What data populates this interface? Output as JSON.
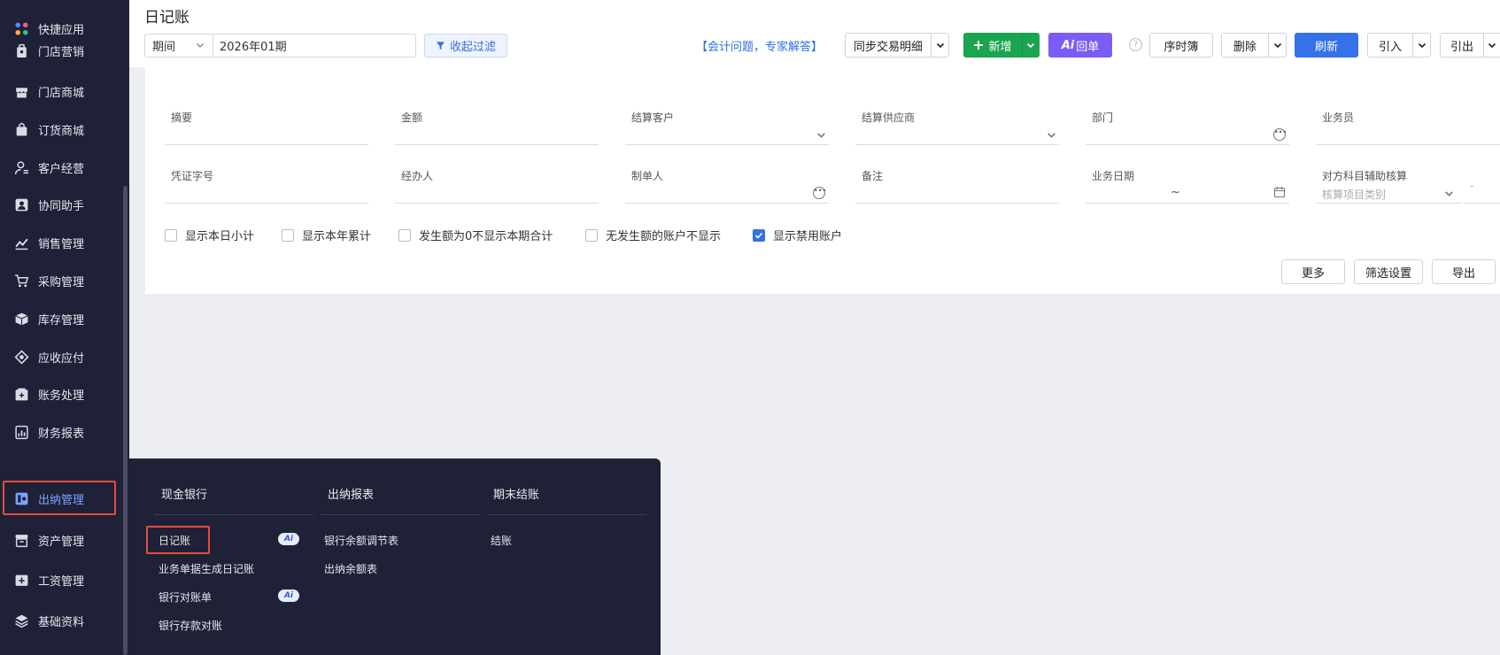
{
  "sidebar": {
    "items": [
      {
        "label": "快捷应用",
        "icon": "apps-icon"
      },
      {
        "label": "门店营销",
        "icon": "store-marketing-icon"
      },
      {
        "label": "门店商城",
        "icon": "store-mall-icon"
      },
      {
        "label": "订货商城",
        "icon": "order-mall-icon"
      },
      {
        "label": "客户经营",
        "icon": "customer-icon"
      },
      {
        "label": "协同助手",
        "icon": "collab-icon"
      },
      {
        "label": "销售管理",
        "icon": "sales-icon"
      },
      {
        "label": "采购管理",
        "icon": "cart-icon"
      },
      {
        "label": "库存管理",
        "icon": "inventory-icon"
      },
      {
        "label": "应收应付",
        "icon": "receivable-icon"
      },
      {
        "label": "账务处理",
        "icon": "ledger-icon"
      },
      {
        "label": "财务报表",
        "icon": "report-icon"
      },
      {
        "label": "出纳管理",
        "icon": "cashier-icon"
      },
      {
        "label": "资产管理",
        "icon": "asset-icon"
      },
      {
        "label": "工资管理",
        "icon": "salary-icon"
      },
      {
        "label": "基础资料",
        "icon": "layers-icon"
      }
    ],
    "active": "出纳管理"
  },
  "header": {
    "title": "日记账",
    "period_label": "期间",
    "period_value": "2026年01期",
    "collapse_filter": "收起过滤",
    "expert_link": "【会计问题，专家解答】",
    "buttons": {
      "sync": "同步交易明细",
      "add": "新增",
      "ai_receipt": "回单",
      "ai_prefix": "Ai",
      "journal_book": "序时簿",
      "delete": "删除",
      "refresh": "刷新",
      "import": "引入",
      "export_out": "引出"
    },
    "help": "?"
  },
  "filters": {
    "row1": [
      {
        "label": "摘要"
      },
      {
        "label": "金额"
      },
      {
        "label": "结算客户"
      },
      {
        "label": "结算供应商"
      },
      {
        "label": "部门"
      },
      {
        "label": "业务员"
      }
    ],
    "row2": [
      {
        "label": "凭证字号"
      },
      {
        "label": "经办人"
      },
      {
        "label": "制单人"
      },
      {
        "label": "备注"
      },
      {
        "label": "业务日期",
        "separator": "~"
      },
      {
        "label": "对方科目辅助核算",
        "placeholder": "核算项目类别",
        "suffix": "-"
      }
    ],
    "checkboxes": [
      {
        "label": "显示本日小计",
        "checked": false
      },
      {
        "label": "显示本年累计",
        "checked": false
      },
      {
        "label": "发生额为0不显示本期合计",
        "checked": false
      },
      {
        "label": "无发生额的账户不显示",
        "checked": false
      },
      {
        "label": "显示禁用账户",
        "checked": true
      }
    ],
    "actions": {
      "more": "更多",
      "filter_settings": "筛选设置",
      "export": "导出"
    }
  },
  "popup": {
    "columns": [
      {
        "title": "现金银行",
        "items": [
          {
            "label": "日记账",
            "ai": true
          },
          {
            "label": "业务单据生成日记账",
            "ai": false
          },
          {
            "label": "银行对账单",
            "ai": true
          },
          {
            "label": "银行存款对账",
            "ai": false
          }
        ]
      },
      {
        "title": "出纳报表",
        "items": [
          {
            "label": "银行余额调节表"
          },
          {
            "label": "出纳余额表"
          }
        ]
      },
      {
        "title": "期末结账",
        "items": [
          {
            "label": "结账"
          }
        ]
      }
    ],
    "ai_badge": "Ai"
  },
  "colors": {
    "sidebar_bg": "#1e2137",
    "primary_blue": "#3571e8",
    "green": "#1aa550",
    "purple": "#7b5cf5",
    "highlight_red": "#e74c3c"
  }
}
